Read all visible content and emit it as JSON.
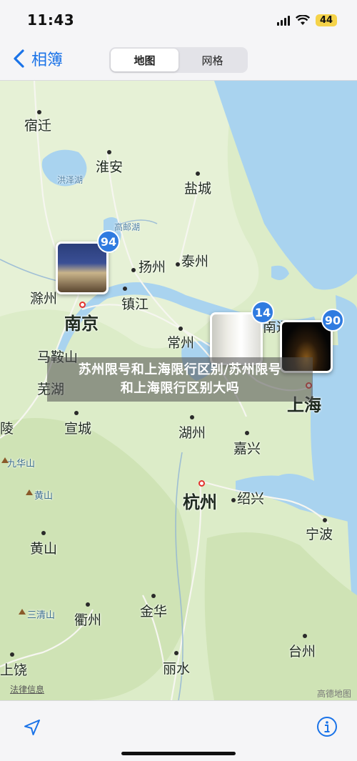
{
  "status": {
    "time": "11:43",
    "battery": "44"
  },
  "nav": {
    "back_label": "相簿",
    "tabs": [
      {
        "label": "地图",
        "active": true
      },
      {
        "label": "网格",
        "active": false
      }
    ]
  },
  "map": {
    "cities": {
      "suqian": "宿迁",
      "huaian": "淮安",
      "yancheng": "盐城",
      "yangzhou": "扬州",
      "taizhou_js": "泰州",
      "chuzhou": "滁州",
      "nanjing": "南京",
      "zhenjiang": "镇江",
      "changzhou": "常州",
      "nantong": "南通",
      "maanshan": "马鞍山",
      "wuhu": "芜湖",
      "shanghai": "上海",
      "xuancheng": "宣城",
      "huzhou": "湖州",
      "jiaxing": "嘉兴",
      "tongling": "陵",
      "hangzhou": "杭州",
      "shaoxing": "绍兴",
      "ningbo": "宁波",
      "huangshan_city": "黄山",
      "quzhou": "衢州",
      "jinhua": "金华",
      "lishui": "丽水",
      "taizhou_zj": "台州",
      "shangrao": "上饶"
    },
    "features": {
      "hongze_lake": "洪泽湖",
      "gaoyou_lake": "高邮湖",
      "jiuhuashan": "九华山",
      "huangshan_mt": "黄山",
      "sanqingshan": "三清山"
    },
    "clusters": [
      {
        "count": "94"
      },
      {
        "count": "14"
      },
      {
        "count": "90"
      }
    ],
    "legal": "法律信息",
    "provider": "高德地图"
  },
  "overlay": {
    "line1": "苏州限号和上海限行区别/苏州限号",
    "line2": "和上海限行区别大吗"
  },
  "colors": {
    "accent": "#1a73e8",
    "badge": "#2f7be0",
    "land": "#dcecc8",
    "water": "#a9d3ef"
  }
}
